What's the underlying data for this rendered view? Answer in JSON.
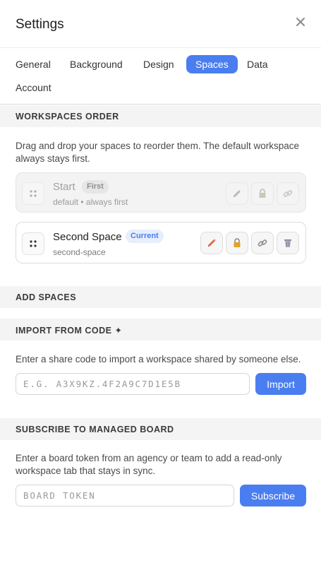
{
  "header": {
    "title": "Settings",
    "close_icon": "close-icon"
  },
  "tabs": [
    {
      "label": "General",
      "active": false
    },
    {
      "label": "Background",
      "active": false
    },
    {
      "label": "Design",
      "active": false
    },
    {
      "label": "Spaces",
      "active": true
    },
    {
      "label": "Data",
      "active": false
    },
    {
      "label": "Account",
      "active": false
    }
  ],
  "workspaces_order": {
    "heading": "WORKSPACES ORDER",
    "description": "Drag and drop your spaces to reorder them. The default workspace always stays first.",
    "spaces": [
      {
        "name": "Start",
        "badge": "First",
        "subtitle": "default • always first",
        "disabled": true
      },
      {
        "name": "Second Space",
        "badge": "Current",
        "subtitle": "second-space",
        "disabled": false
      }
    ]
  },
  "add_spaces": {
    "heading": "ADD SPACES"
  },
  "import_from_code": {
    "heading": "IMPORT FROM CODE ✦",
    "description": "Enter a share code to import a workspace shared by someone else.",
    "placeholder": "E.G. A3X9KZ.4F2A9C7D1E5B",
    "button_label": "Import"
  },
  "subscribe": {
    "heading": "SUBSCRIBE TO MANAGED BOARD",
    "description": "Enter a board token from an agency or team to add a read-only workspace tab that stays in sync.",
    "placeholder": "BOARD TOKEN",
    "button_label": "Subscribe"
  },
  "colors": {
    "accent": "#4a7ef0",
    "pencil_active": "#e8663d",
    "lock_active": "#e4a020"
  }
}
